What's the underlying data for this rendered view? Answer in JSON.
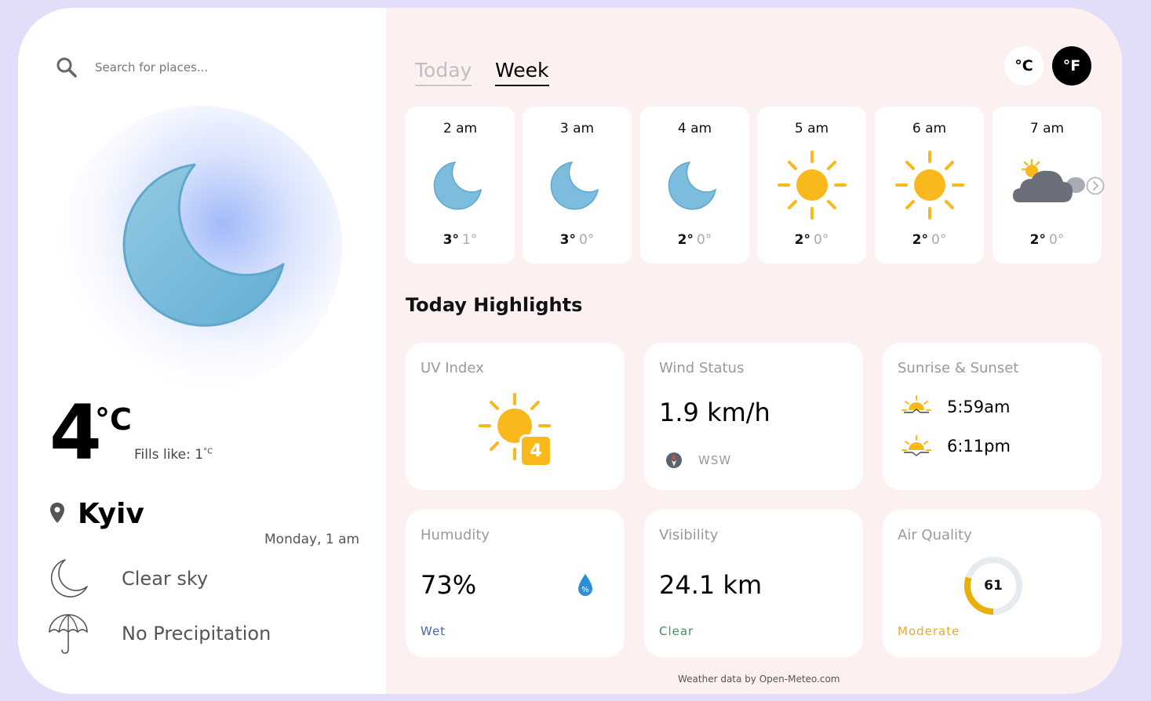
{
  "search": {
    "placeholder": "Search for places..."
  },
  "current": {
    "temp": "4",
    "unit": "°C",
    "feels_like_label": "Fills like: 1",
    "feels_like_unit": "°C",
    "city": "Kyiv",
    "datetime": "Monday, 1 am",
    "condition": "Clear sky",
    "precipitation": "No Precipitation",
    "icon": "moon-icon"
  },
  "tabs": {
    "today": "Today",
    "week": "Week",
    "active": "week"
  },
  "units": {
    "celsius": "°C",
    "fahrenheit": "°F",
    "active": "fahrenheit"
  },
  "hourly": [
    {
      "time": "2 am",
      "hi": "3°",
      "lo": "1°",
      "icon": "moon-icon"
    },
    {
      "time": "3 am",
      "hi": "3°",
      "lo": "0°",
      "icon": "moon-icon"
    },
    {
      "time": "4 am",
      "hi": "2°",
      "lo": "0°",
      "icon": "moon-icon"
    },
    {
      "time": "5 am",
      "hi": "2°",
      "lo": "0°",
      "icon": "sun-icon"
    },
    {
      "time": "6 am",
      "hi": "2°",
      "lo": "0°",
      "icon": "sun-icon"
    },
    {
      "time": "7 am",
      "hi": "2°",
      "lo": "0°",
      "icon": "cloud-sun-icon"
    }
  ],
  "highlights": {
    "title": "Today Highlights",
    "uv": {
      "title": "UV Index",
      "value": "4"
    },
    "wind": {
      "title": "Wind Status",
      "value": "1.9 km/h",
      "direction": "WSW"
    },
    "sun": {
      "title": "Sunrise & Sunset",
      "sunrise": "5:59am",
      "sunset": "6:11pm"
    },
    "humidity": {
      "title": "Humudity",
      "value": "73%",
      "status": "Wet"
    },
    "visibility": {
      "title": "Visibility",
      "value": "24.1 km",
      "status": "Clear"
    },
    "air": {
      "title": "Air Quality",
      "value": "61",
      "status": "Moderate",
      "gauge_fraction": 0.3
    }
  },
  "colors": {
    "moon": "#7cbcdc",
    "sun": "#f9b91c",
    "cloud": "#6b6f7a",
    "humidity_status": "#4a62a8",
    "visibility_status": "#4b8a5e",
    "air_status": "#e2ac2d",
    "gauge": "#e8b008"
  },
  "footer": "Weather data by Open-Meteo.com"
}
